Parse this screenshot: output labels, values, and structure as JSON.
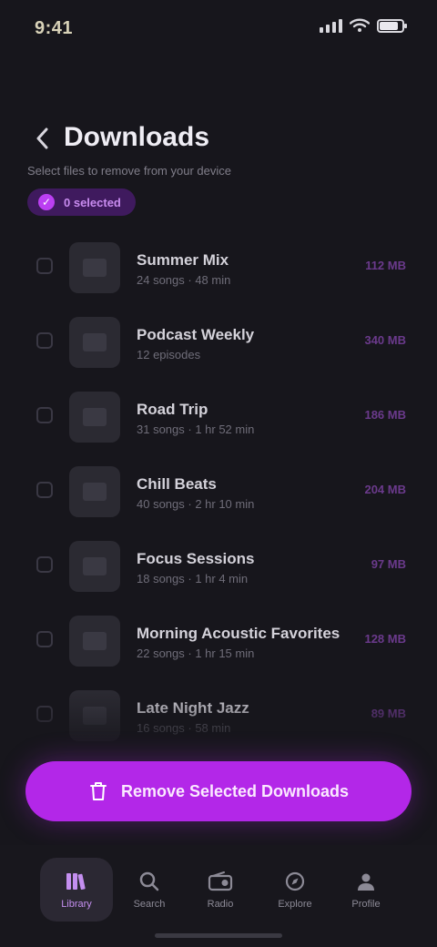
{
  "status_bar": {
    "time": "9:41",
    "battery_level": 0.85
  },
  "header": {
    "back_icon": "chevron-left-icon",
    "title": "Downloads",
    "subtitle": "Select files to remove from your device",
    "selection_label": "0 selected"
  },
  "items": [
    {
      "name": "Summer Mix",
      "meta": "24 songs · 48 min",
      "size": "112 MB",
      "icon": "album-icon"
    },
    {
      "name": "Podcast Weekly",
      "meta": "12 episodes",
      "size": "340 MB",
      "icon": "podcast-icon"
    },
    {
      "name": "Road Trip",
      "meta": "31 songs · 1 hr 52 min",
      "size": "186 MB",
      "icon": "album-icon"
    },
    {
      "name": "Chill Beats",
      "meta": "40 songs · 2 hr 10 min",
      "size": "204 MB",
      "icon": "album-icon"
    },
    {
      "name": "Focus Sessions",
      "meta": "18 songs · 1 hr 4 min",
      "size": "97 MB",
      "icon": "album-icon"
    },
    {
      "name": "Morning Acoustic Favorites",
      "meta": "22 songs · 1 hr 15 min",
      "size": "128 MB",
      "icon": "album-icon"
    },
    {
      "name": "Late Night Jazz",
      "meta": "16 songs · 58 min",
      "size": "89 MB",
      "icon": "album-icon"
    }
  ],
  "cta": {
    "label": "Remove Selected Downloads",
    "icon": "trash-icon"
  },
  "nav": [
    {
      "label": "Library",
      "icon": "library-icon",
      "active": true
    },
    {
      "label": "Search",
      "icon": "search-icon",
      "active": false
    },
    {
      "label": "Radio",
      "icon": "radio-icon",
      "active": false
    },
    {
      "label": "Explore",
      "icon": "explore-icon",
      "active": false
    },
    {
      "label": "Profile",
      "icon": "profile-icon",
      "active": false
    }
  ],
  "colors": {
    "accent": "#b327e8",
    "background": "#17161c"
  }
}
